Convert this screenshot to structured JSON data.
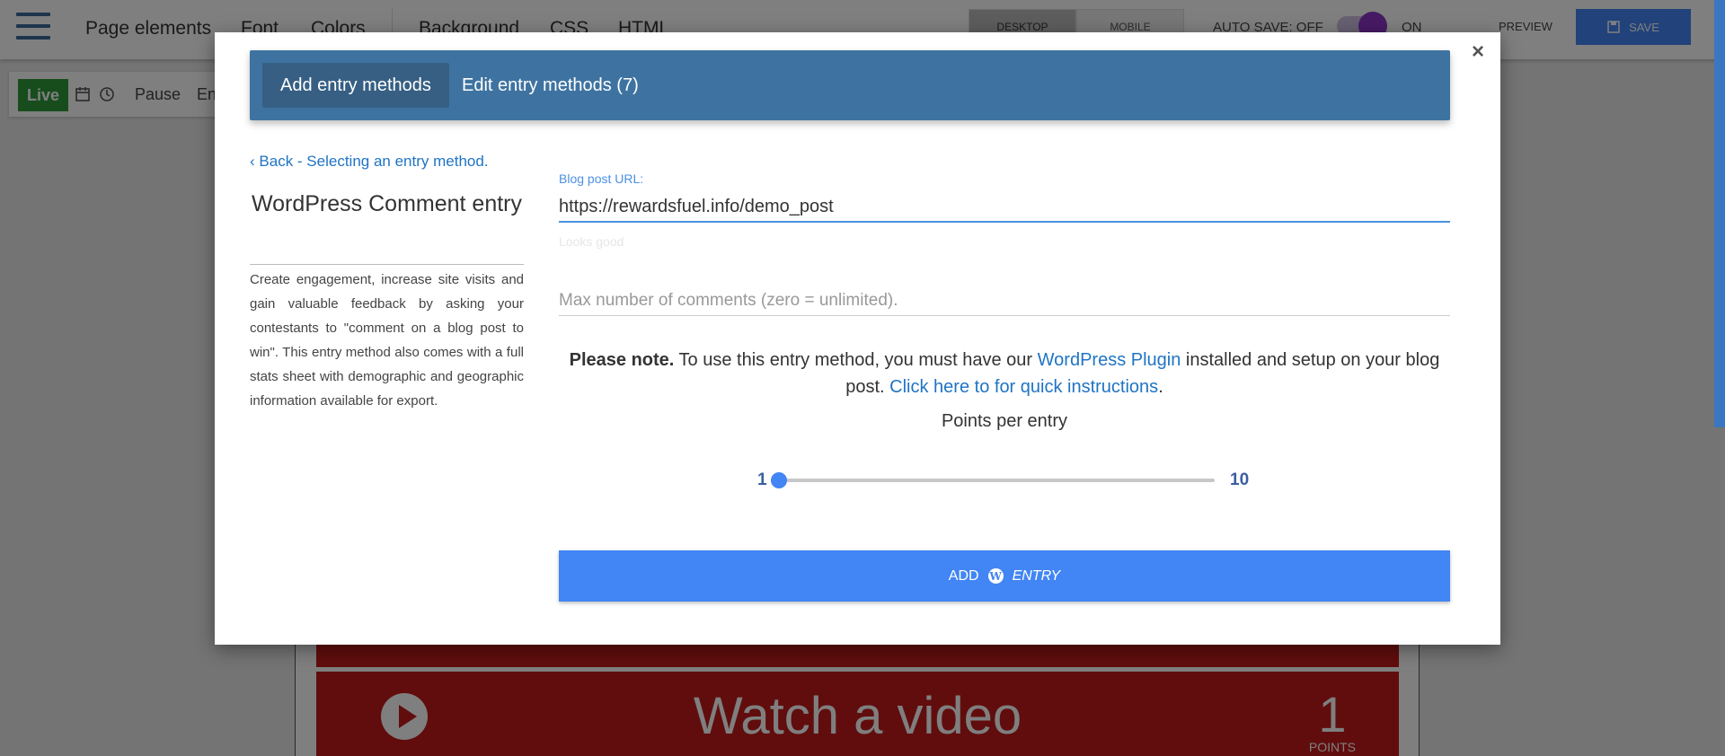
{
  "topbar": {
    "nav": [
      "Page elements",
      "Font",
      "Colors",
      "Background",
      "CSS",
      "HTML"
    ],
    "device_desktop": "DESKTOP",
    "device_mobile": "MOBILE",
    "autosave": "AUTO SAVE: OFF",
    "on_label": "ON",
    "preview": "PREVIEW",
    "save": "SAVE"
  },
  "toolbar": {
    "live": "Live",
    "pause": "Pause",
    "end_partial": "En"
  },
  "canvas": {
    "video_entry_title": "Watch a video",
    "video_entry_points": "1",
    "points_label": "POINTS"
  },
  "modal": {
    "tabs": [
      "Add entry methods",
      "Edit entry methods (7)"
    ],
    "back_link": "Back - Selecting an entry method.",
    "side_title": "WordPress Comment entry",
    "side_description": "Create engagement, increase site visits and gain valuable feedback by asking your contestants to \"comment on a blog post to win\". This entry method also comes with a full stats sheet with demographic and geographic information available for export.",
    "url_label": "Blog post URL:",
    "url_value": "https://rewardsfuel.info/demo_post",
    "url_hint": "Looks good",
    "max_comments_placeholder": "Max number of comments (zero = unlimited).",
    "note_bold": "Please note.",
    "note_text1": " To use this entry method, you must have our ",
    "note_link1": "WordPress Plugin",
    "note_text2": " installed and setup on your blog post. ",
    "note_link2": "Click here to for quick instructions",
    "note_text3": ".",
    "points_per_entry_label": "Points per entry",
    "slider_min": "1",
    "slider_max": "10",
    "slider_value": 1,
    "add_button_prefix": "ADD",
    "add_button_suffix": "ENTRY",
    "close_symbol": "×"
  },
  "colors": {
    "primary": "#4285f4",
    "tab_bar": "#3e73a1",
    "live": "#2e9b3a",
    "entry_red": "#c21a1a",
    "link": "#1f74c4"
  }
}
